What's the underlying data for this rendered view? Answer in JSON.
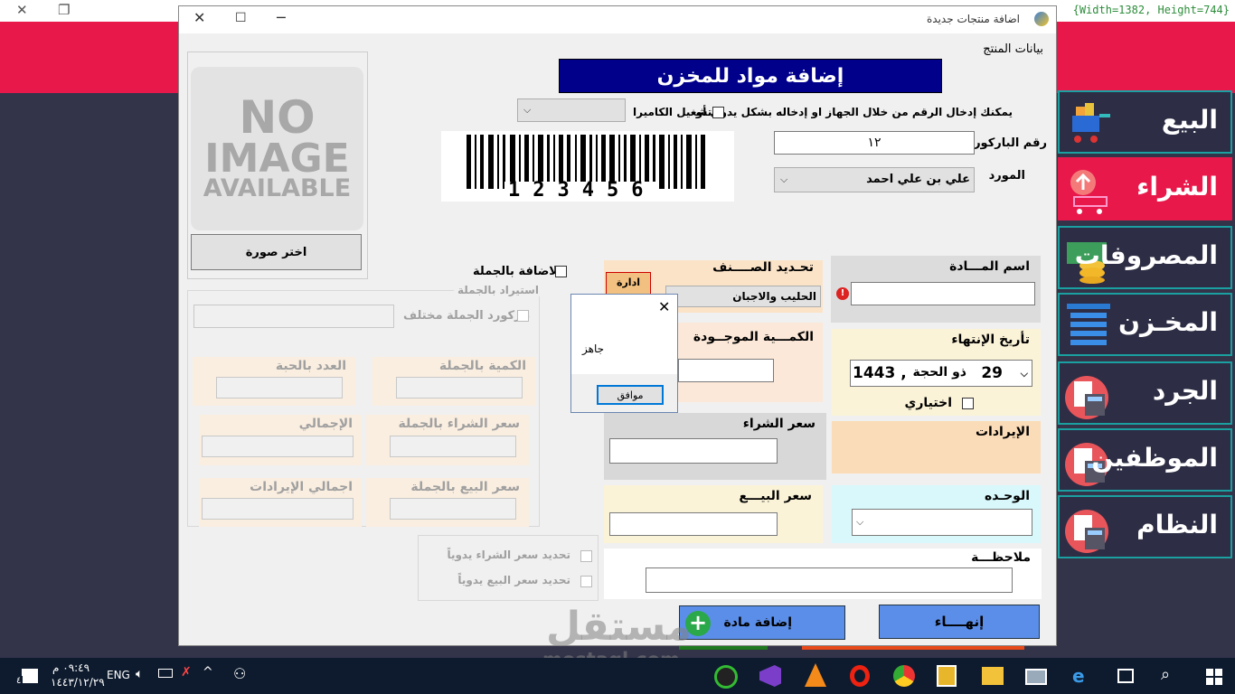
{
  "main_window": {
    "size_indicator": "{Width=1382, Height=744}",
    "nav_items": [
      {
        "label": "البيع",
        "icon": "shopping-cart-icon"
      },
      {
        "label": "الشراء",
        "icon": "purchase-cart-icon",
        "active": true
      },
      {
        "label": "المصروفات",
        "icon": "money-icon"
      },
      {
        "label": "المخـزن",
        "icon": "warehouse-icon"
      },
      {
        "label": "الجرد",
        "icon": "calculator-icon"
      },
      {
        "label": "الموظفين",
        "icon": "calculator-icon"
      },
      {
        "label": "النظام",
        "icon": "calculator-icon"
      }
    ]
  },
  "dialog": {
    "title": "اضافة منتجات جديدة",
    "group_title": "بيانات المنتج",
    "header": "إضافة مواد للمخزن",
    "barcode_hint": "يمكنك إدخال الرقم من خلال الجهاز او إدخاله بشكل يدوي أو",
    "camera_label": "تشغيل الكاميرا",
    "barcode_label": "رقم الباركورد",
    "barcode_value": "١٢",
    "barcode_digits": "123456",
    "supplier_label": "المورد",
    "supplier_value": "علي بن علي احمد",
    "no_image": [
      "NO",
      "IMAGE",
      "AVAILABLE"
    ],
    "choose_image": "اختر صورة",
    "material_name_label": "اسم المـــادة",
    "category_label": "تحـديد الصــــنف",
    "manage_button": "ادارة",
    "category_value": "الحليب والاجبان",
    "wholesale_add": "الاضافة بالجملة",
    "wholesale_import": "استيراد بالجملة",
    "wholesale_barcode_diff": "باركورد الجملة مختلف",
    "wholesale_qty": "الكمية بالجملة",
    "piece_count": "العدد بالحبة",
    "wholesale_buy_price": "سعر الشراء بالجملة",
    "total": "الإجمالي",
    "wholesale_sell_price": "سعر البيع بالجملة",
    "total_revenue": "اجمالي الإيرادات",
    "manual_buy_price": "تحديد سعر الشراء يدوياً",
    "manual_sell_price": "تحديد سعر البيع يدوياً",
    "expiry_label": "تأريخ الإنتهاء",
    "expiry_day": "29",
    "expiry_month": "ذو الحجة",
    "expiry_year": "1443 ,",
    "optional_label": "اختياري",
    "existing_qty_label": "الكمـــية الموجــودة",
    "purchase_price_label": "سعر الشراء",
    "revenue_label": "الإيرادات",
    "sell_price_label": "سعر البيـــع",
    "unit_label": "الوحـده",
    "notes_label": "ملاحظـــة",
    "finish_button": "إنهــــاء",
    "add_button": "إضافة مادة"
  },
  "message_box": {
    "text": "جاهز",
    "ok_button": "موافق"
  },
  "taskbar": {
    "time": "٠٩:٤٩ م",
    "date": "١٤٤٣/١٢/٢٩",
    "lang": "ENG",
    "notification_count": "٤"
  },
  "watermark": {
    "arabic": "مستقل",
    "latin": "mostaql.com"
  }
}
